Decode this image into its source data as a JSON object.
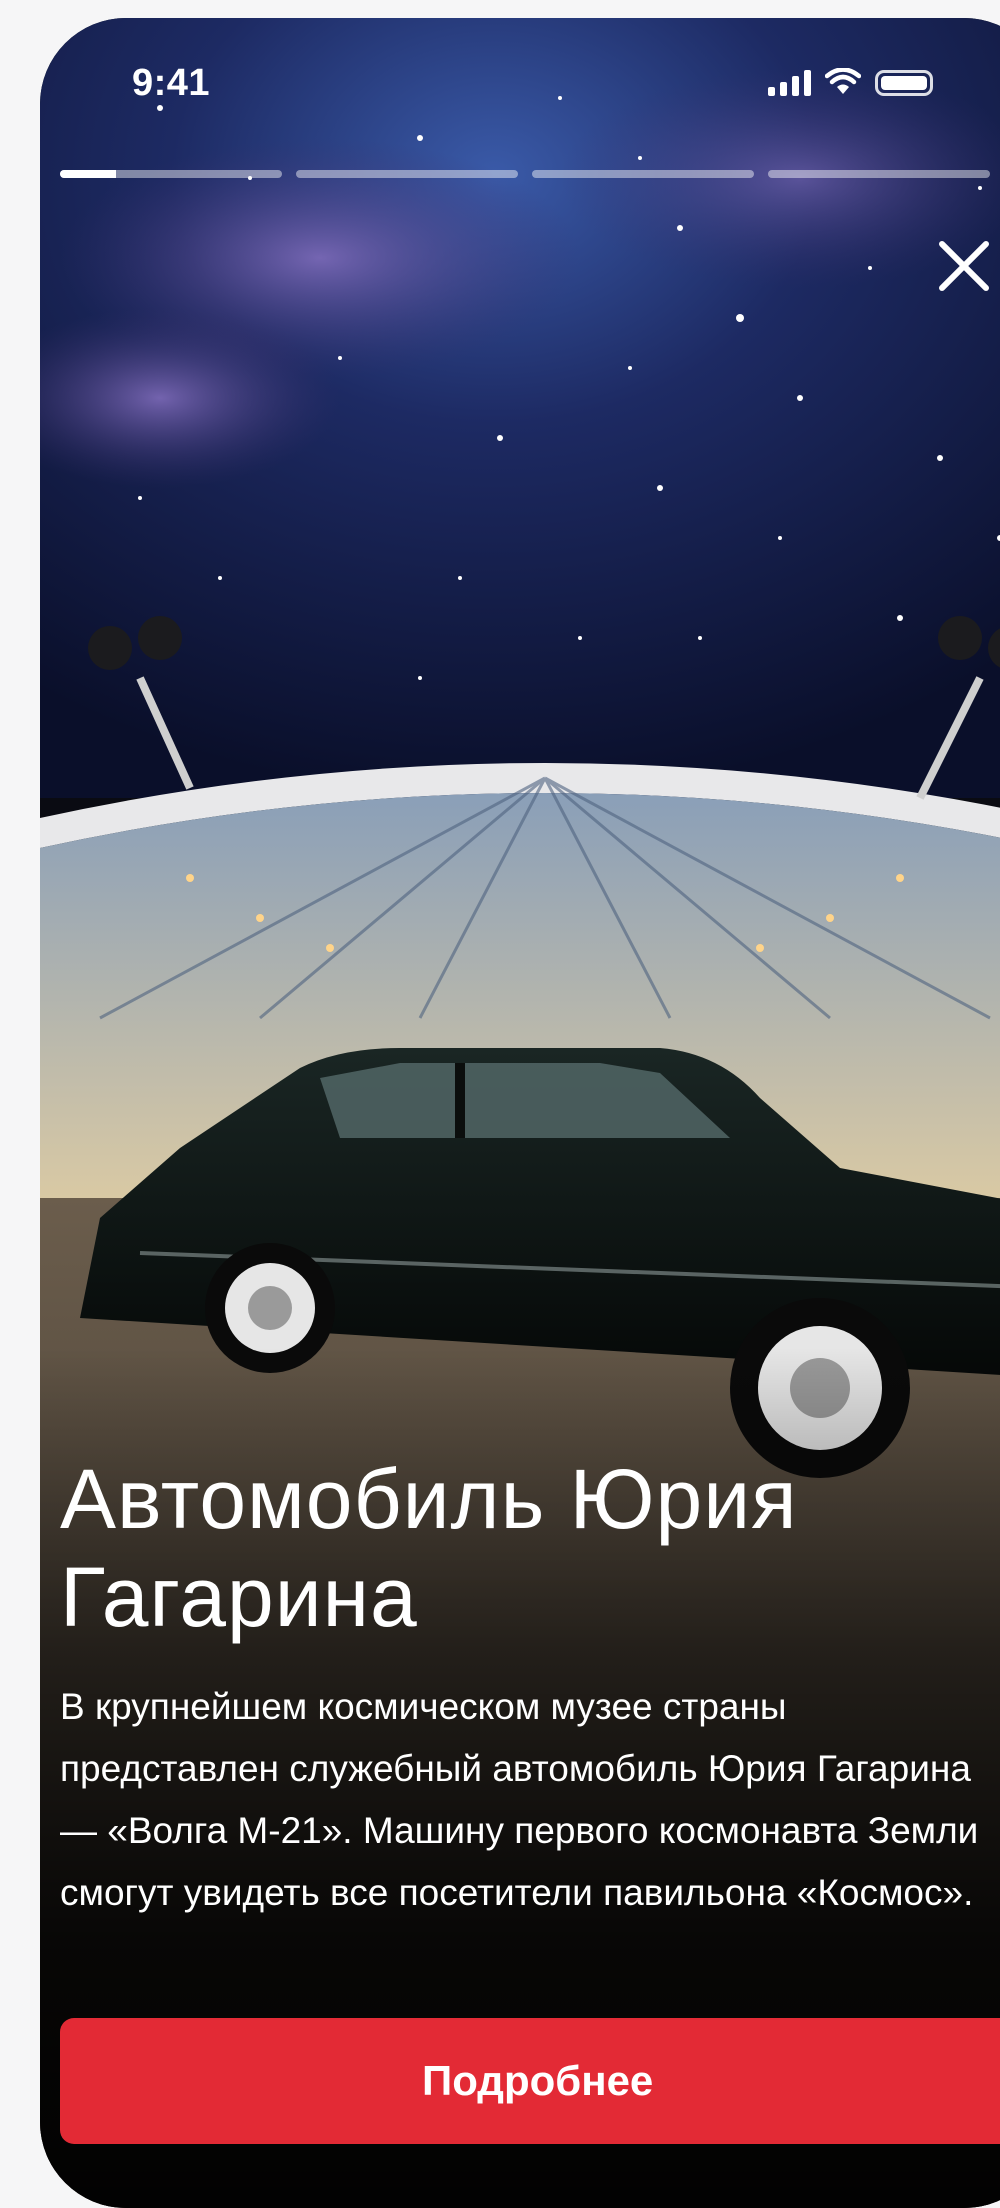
{
  "status_bar": {
    "time": "9:41",
    "signal_icon": "cellular-signal-icon",
    "wifi_icon": "wifi-icon",
    "battery_icon": "battery-icon"
  },
  "story": {
    "progress_segments": [
      0.25,
      0,
      0,
      0
    ],
    "close_icon": "close-icon",
    "image_icon": "photo-pavilion-car",
    "title": "Автомобиль Юрия Гагарина",
    "description": "В крупнейшем космическом музее страны представлен служебный автомобиль Юрия Гагарина — «Волга М-21». Машину первого космонавта Земли смогут увидеть все посетители павильона «Космос».",
    "cta_label": "Подробнее"
  },
  "colors": {
    "accent": "#e32a35",
    "text": "#ffffff",
    "background": "#0a0b12"
  }
}
